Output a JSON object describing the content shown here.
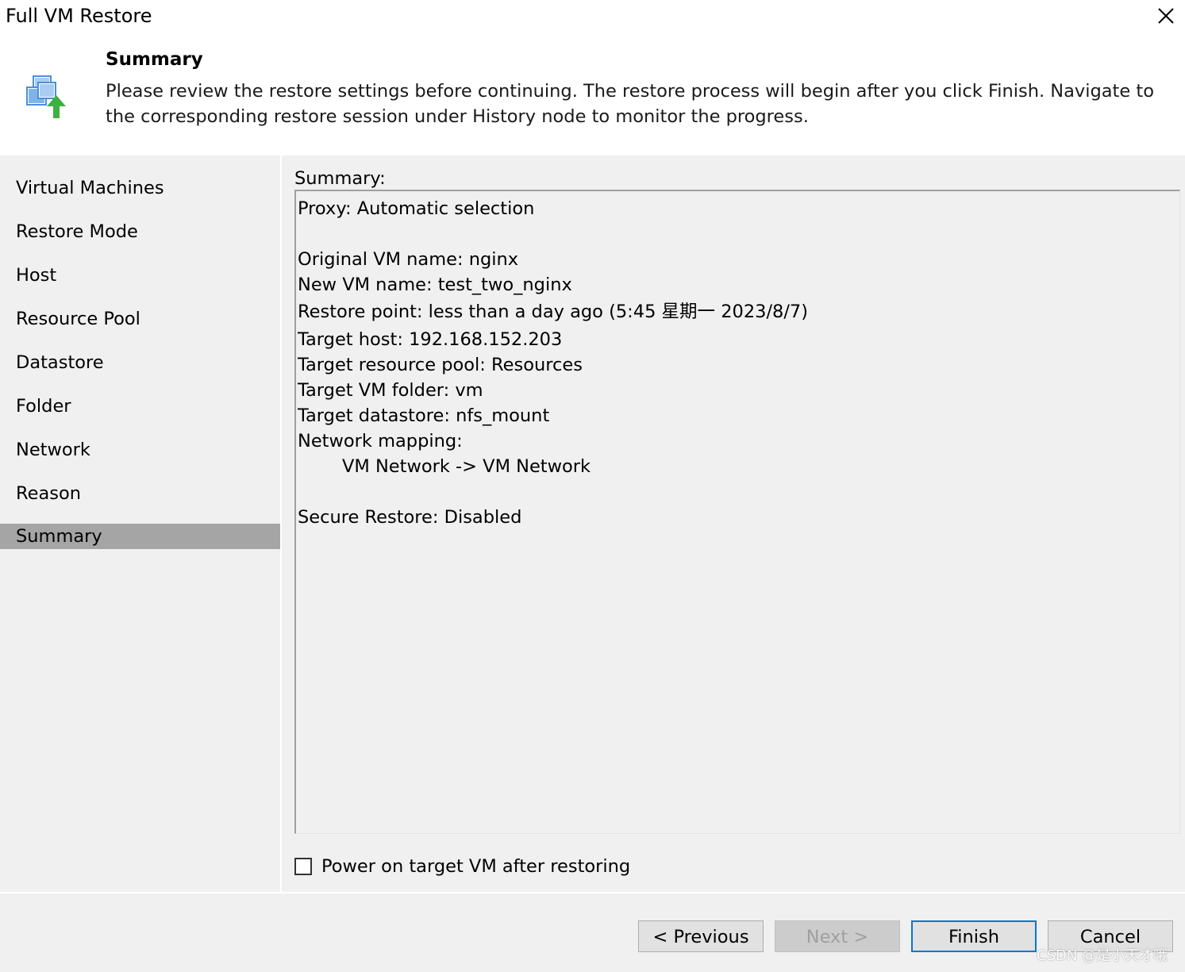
{
  "window": {
    "title": "Full VM Restore",
    "close_icon": "close-icon"
  },
  "header": {
    "icon": "vm-restore-icon",
    "heading": "Summary",
    "description": "Please review the restore settings before continuing. The restore process will begin after you click Finish. Navigate to the corresponding restore session under History node to monitor the progress."
  },
  "sidebar": {
    "items": [
      {
        "label": "Virtual Machines",
        "active": false
      },
      {
        "label": "Restore Mode",
        "active": false
      },
      {
        "label": "Host",
        "active": false
      },
      {
        "label": "Resource Pool",
        "active": false
      },
      {
        "label": "Datastore",
        "active": false
      },
      {
        "label": "Folder",
        "active": false
      },
      {
        "label": "Network",
        "active": false
      },
      {
        "label": "Reason",
        "active": false
      },
      {
        "label": "Summary",
        "active": true
      }
    ]
  },
  "main": {
    "summary_label": "Summary:",
    "summary_lines": {
      "proxy": "Proxy: Automatic selection",
      "original_vm": "Original VM name: nginx",
      "new_vm": "New VM name: test_two_nginx",
      "restore_point": "Restore point: less than a day ago (5:45 星期一 2023/8/7)",
      "target_host": "Target host: 192.168.152.203",
      "target_pool": "Target resource pool: Resources",
      "target_folder": "Target VM folder: vm",
      "target_datastore": "Target datastore: nfs_mount",
      "network_mapping": "Network mapping:",
      "network_map_entry": "VM Network -> VM Network",
      "secure_restore": "Secure Restore: Disabled"
    },
    "power_on_checkbox": {
      "label": "Power on target VM after restoring",
      "checked": false
    }
  },
  "footer": {
    "previous": "< Previous",
    "next": "Next >",
    "finish": "Finish",
    "cancel": "Cancel"
  },
  "watermark": "CSDN @是小天才哦",
  "colors": {
    "active_item": "#a5a5a5",
    "default_button_border": "#0078d7",
    "icon_blue": "#4a90d9",
    "icon_green": "#3cb043"
  }
}
